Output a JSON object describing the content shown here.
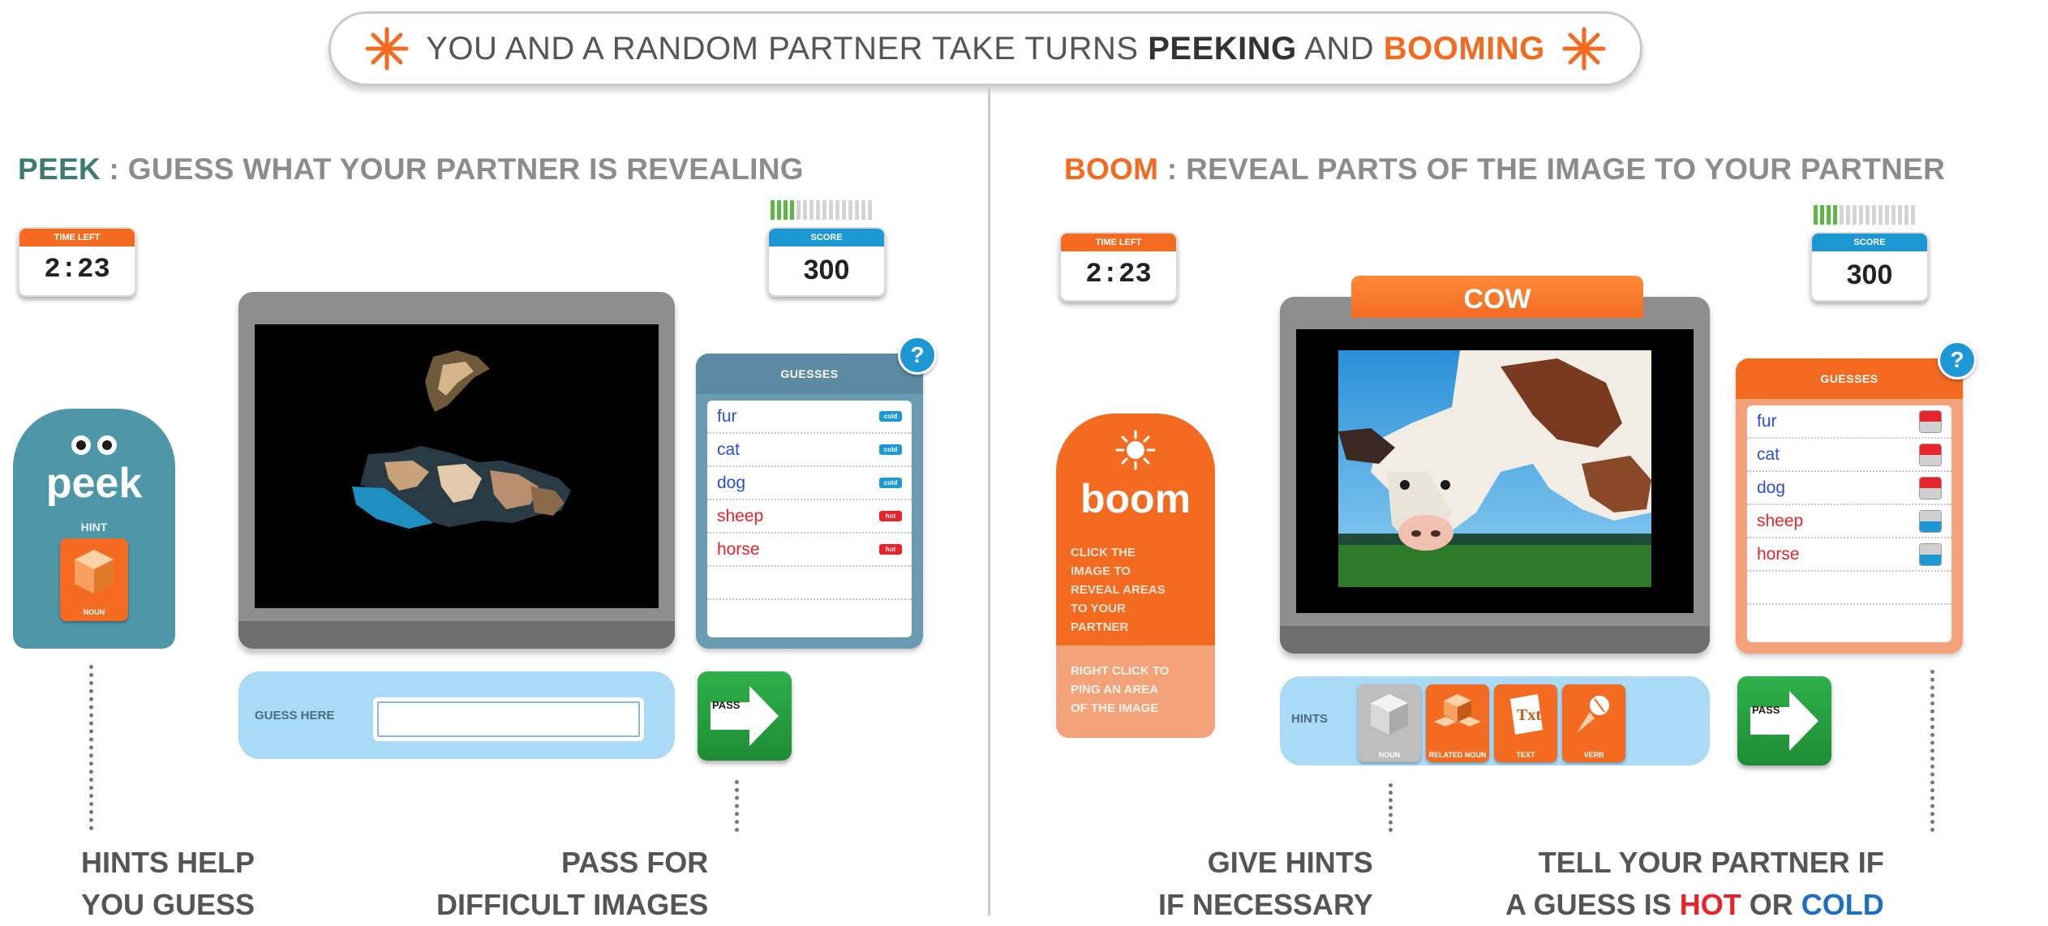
{
  "banner": {
    "pre": "YOU AND A RANDOM PARTNER TAKE TURNS ",
    "peeking": "PEEKING",
    "and": " AND ",
    "booming": "BOOMING"
  },
  "peek": {
    "title_key": "PEEK",
    "title_rest": " : GUESS WHAT YOUR PARTNER IS REVEALING",
    "time_label": "TIME LEFT",
    "time_value": "2:23",
    "score_label": "SCORE",
    "score_value": "300",
    "score_meter_fraction": 0.25,
    "badge_name": "peek",
    "hint_label": "HINT",
    "hint_tile_label": "NOUN",
    "guesses_title": "GUESSES",
    "guesses": [
      {
        "word": "fur",
        "tag": "cold"
      },
      {
        "word": "cat",
        "tag": "cold"
      },
      {
        "word": "dog",
        "tag": "cold"
      },
      {
        "word": "sheep",
        "tag": "hot"
      },
      {
        "word": "horse",
        "tag": "hot"
      }
    ],
    "guess_label": "GUESS HERE",
    "guess_value": "",
    "pass_label": "PASS",
    "caption_left_1": "HINTS HELP",
    "caption_left_2": "YOU GUESS",
    "caption_right_1": "PASS FOR",
    "caption_right_2": "DIFFICULT IMAGES"
  },
  "boom": {
    "title_key": "BOOM",
    "title_rest": " : REVEAL PARTS OF THE IMAGE TO YOUR PARTNER",
    "time_label": "TIME LEFT",
    "time_value": "2:23",
    "score_label": "SCORE",
    "score_value": "300",
    "score_meter_fraction": 0.25,
    "word": "COW",
    "badge_name": "boom",
    "badge_text": "CLICK THE IMAGE TO REVEAL AREAS TO YOUR PARTNER",
    "badge_text2": "RIGHT CLICK TO PING AN AREA OF THE IMAGE",
    "guesses_title": "GUESSES",
    "guesses": [
      {
        "word": "fur"
      },
      {
        "word": "cat"
      },
      {
        "word": "dog"
      },
      {
        "word": "sheep"
      },
      {
        "word": "horse"
      }
    ],
    "hints_label": "HINTS",
    "hint_tiles": [
      "NOUN",
      "RELATED NOUN",
      "TEXT",
      "VERB"
    ],
    "pass_label": "PASS",
    "caption_left_1": "GIVE HINTS",
    "caption_left_2": "IF NECESSARY",
    "caption_right_1": "TELL YOUR PARTNER IF",
    "caption_right_2_pre": "A GUESS IS ",
    "caption_hot": "HOT",
    "caption_or": " OR ",
    "caption_cold": "COLD"
  },
  "colors": {
    "orange": "#f26b21",
    "teal": "#4e97a8",
    "blue": "#1e98d4",
    "hot": "#e8232a",
    "cold": "#1e6fc4",
    "green": "#2fb04a"
  },
  "icons": [
    "star-icon",
    "cube-icon",
    "arrow-right-icon",
    "help-icon",
    "sun-icon",
    "eyes-icon"
  ]
}
